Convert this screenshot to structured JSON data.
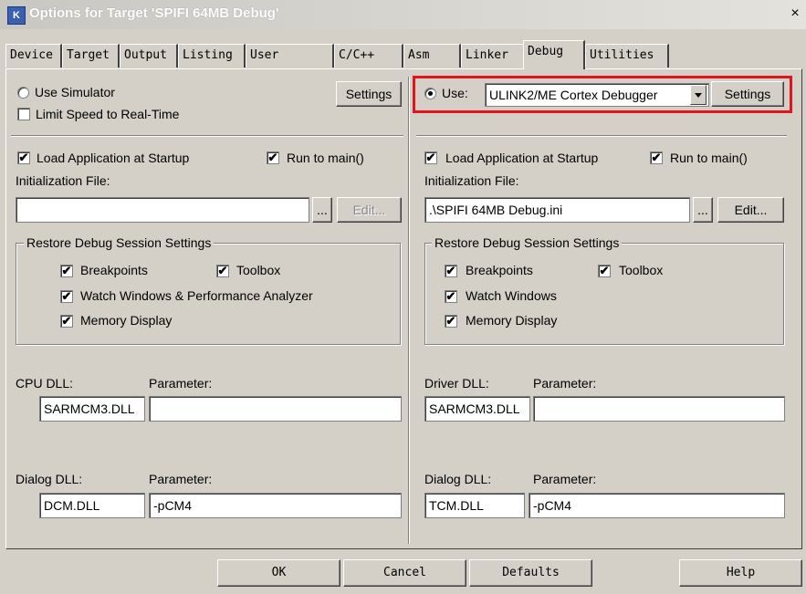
{
  "window": {
    "title": "Options for Target 'SPIFI 64MB Debug'",
    "app_icon": "keil-uvision-icon",
    "close": "×"
  },
  "tabs": [
    {
      "label": "Device"
    },
    {
      "label": "Target"
    },
    {
      "label": "Output"
    },
    {
      "label": "Listing"
    },
    {
      "label": "User"
    },
    {
      "label": "C/C++"
    },
    {
      "label": "Asm"
    },
    {
      "label": "Linker"
    },
    {
      "label": "Debug",
      "active": true
    },
    {
      "label": "Utilities"
    }
  ],
  "left": {
    "use_simulator": "Use Simulator",
    "settings": "Settings",
    "limit_speed": "Limit Speed to Real-Time",
    "load_app": "Load Application at Startup",
    "run_to_main": "Run to main()",
    "init_file_label": "Initialization File:",
    "init_file_value": "",
    "browse": "...",
    "edit": "Edit...",
    "restore_title": "Restore Debug Session Settings",
    "breakpoints": "Breakpoints",
    "toolbox": "Toolbox",
    "watch": "Watch Windows & Performance Analyzer",
    "memory": "Memory Display",
    "cpu_dll_label": "CPU DLL:",
    "cpu_param_label": "Parameter:",
    "cpu_dll_value": "SARMCM3.DLL",
    "cpu_param_value": "",
    "dialog_dll_label": "Dialog DLL:",
    "dialog_param_label": "Parameter:",
    "dialog_dll_value": "DCM.DLL",
    "dialog_param_value": "-pCM4"
  },
  "right": {
    "use": "Use:",
    "debugger": "ULINK2/ME Cortex Debugger",
    "settings": "Settings",
    "load_app": "Load Application at Startup",
    "run_to_main": "Run to main()",
    "init_file_label": "Initialization File:",
    "init_file_value": ".\\SPIFI 64MB Debug.ini",
    "browse": "...",
    "edit": "Edit...",
    "restore_title": "Restore Debug Session Settings",
    "breakpoints": "Breakpoints",
    "toolbox": "Toolbox",
    "watch": "Watch Windows",
    "memory": "Memory Display",
    "driver_dll_label": "Driver DLL:",
    "driver_param_label": "Parameter:",
    "driver_dll_value": "SARMCM3.DLL",
    "driver_param_value": "",
    "dialog_dll_label": "Dialog DLL:",
    "dialog_param_label": "Parameter:",
    "dialog_dll_value": "TCM.DLL",
    "dialog_param_value": "-pCM4"
  },
  "checks": {
    "checked_mark": "✔"
  },
  "footer": {
    "ok": "OK",
    "cancel": "Cancel",
    "defaults": "Defaults",
    "help": "Help"
  },
  "colors": {
    "highlight": "#e0141a",
    "titlebar_text": "#ffffff"
  }
}
